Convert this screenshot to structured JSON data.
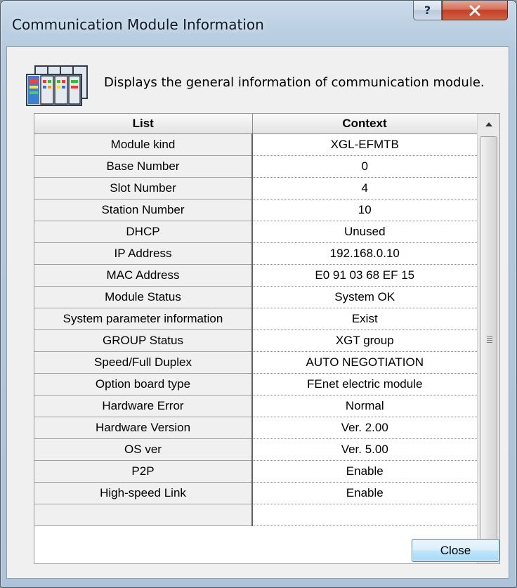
{
  "window": {
    "title": "Communication Module Information",
    "help_icon": "help-question-icon",
    "close_icon": "close-x-icon"
  },
  "header": {
    "icon": "plc-module-icon",
    "description": "Displays the general information of communication module."
  },
  "grid": {
    "columns": [
      "List",
      "Context"
    ],
    "rows": [
      {
        "key": "Module kind",
        "value": "XGL-EFMTB"
      },
      {
        "key": "Base Number",
        "value": "0"
      },
      {
        "key": "Slot Number",
        "value": "4"
      },
      {
        "key": "Station Number",
        "value": "10"
      },
      {
        "key": "DHCP",
        "value": "Unused"
      },
      {
        "key": "IP Address",
        "value": "192.168.0.10"
      },
      {
        "key": "MAC Address",
        "value": "E0 91 03 68 EF 15"
      },
      {
        "key": "Module Status",
        "value": "System OK"
      },
      {
        "key": "System parameter information",
        "value": "Exist"
      },
      {
        "key": "GROUP Status",
        "value": "XGT group"
      },
      {
        "key": "Speed/Full Duplex",
        "value": "AUTO NEGOTIATION"
      },
      {
        "key": "Option board type",
        "value": "FEnet electric module"
      },
      {
        "key": "Hardware Error",
        "value": "Normal"
      },
      {
        "key": "Hardware Version",
        "value": "Ver. 2.00"
      },
      {
        "key": "OS ver",
        "value": "Ver. 5.00"
      },
      {
        "key": "P2P",
        "value": "Enable"
      },
      {
        "key": "High-speed Link",
        "value": "Enable"
      }
    ]
  },
  "buttons": {
    "close_label": "Close"
  }
}
